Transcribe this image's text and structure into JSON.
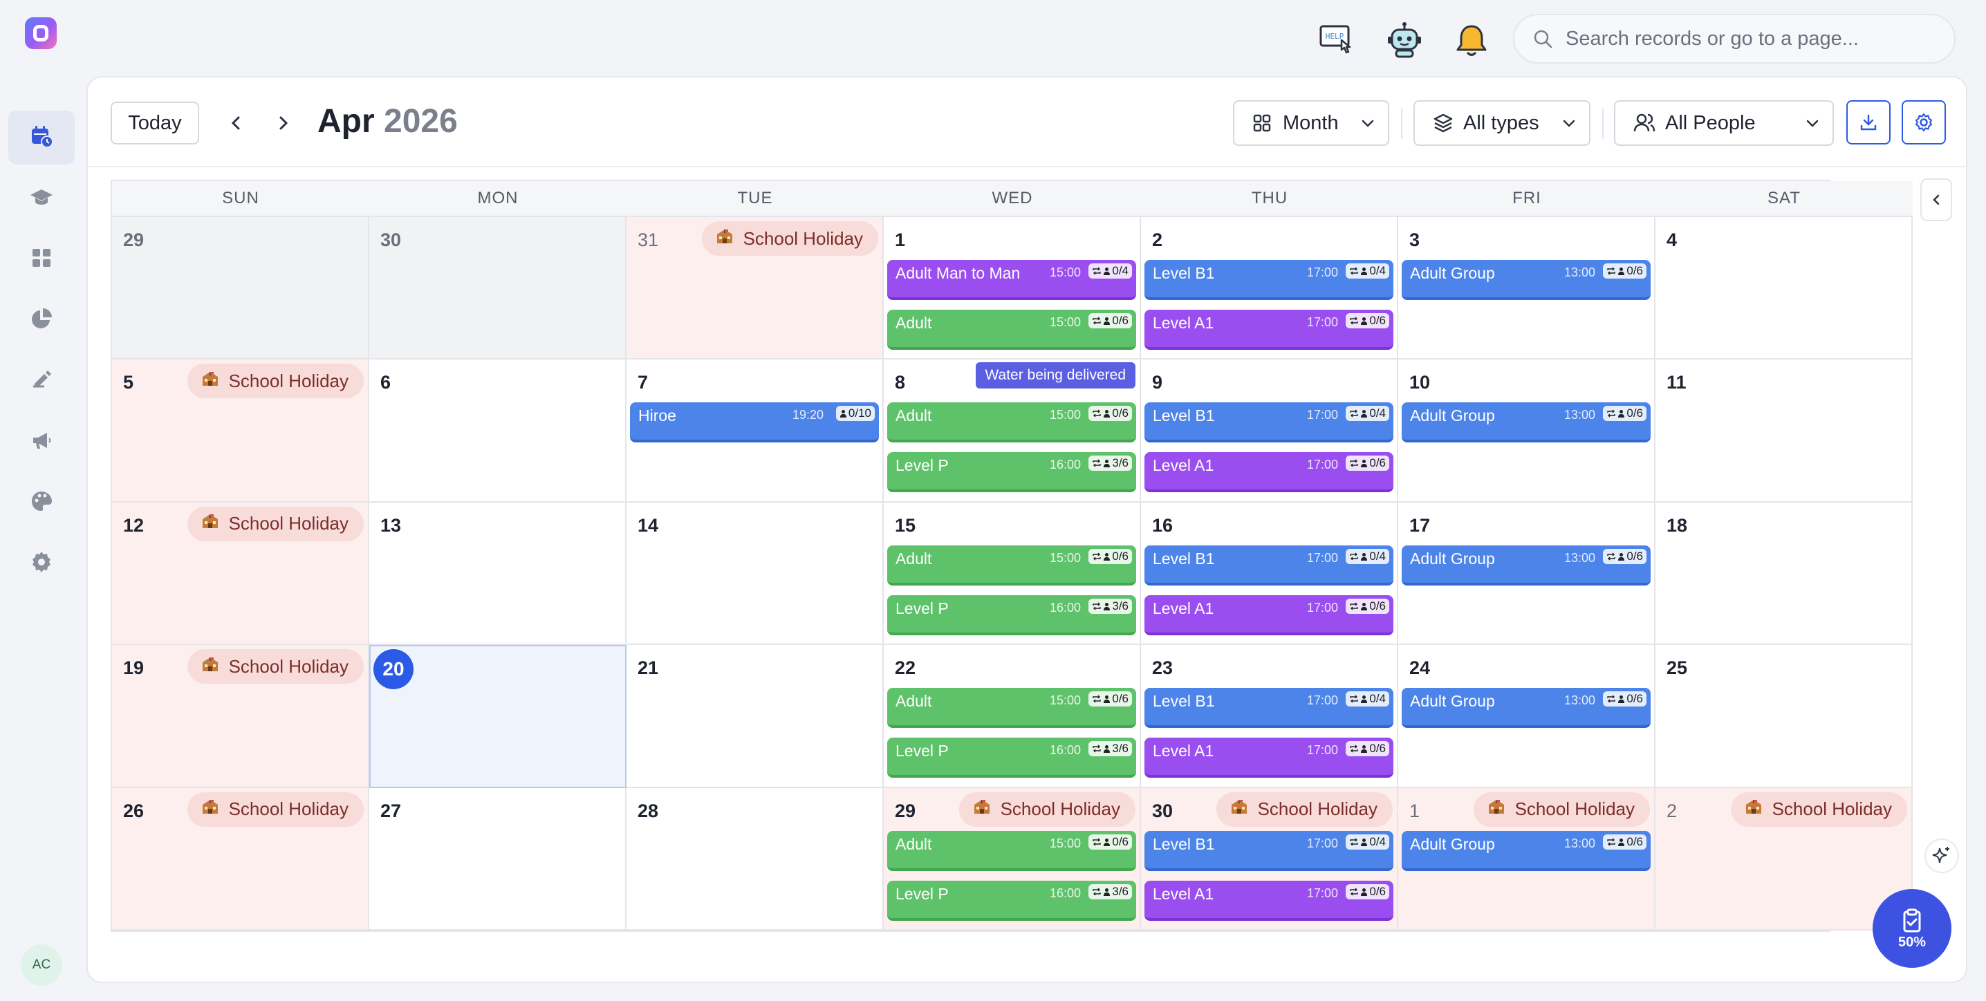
{
  "nav": {
    "items": [
      {
        "icon": "calendar-icon",
        "active": true
      },
      {
        "icon": "graduation-cap-icon",
        "active": false
      },
      {
        "icon": "dashboard-grid-icon",
        "active": false
      },
      {
        "icon": "pie-chart-icon",
        "active": false
      },
      {
        "icon": "signature-icon",
        "active": false
      },
      {
        "icon": "megaphone-icon",
        "active": false
      },
      {
        "icon": "palette-icon",
        "active": false
      },
      {
        "icon": "settings-gear-icon",
        "active": false
      }
    ],
    "avatar_initials": "AC"
  },
  "topbar": {
    "help_icon_label": "HELP",
    "search_placeholder": "Search records or go to a page..."
  },
  "toolbar": {
    "today_label": "Today",
    "month": "Apr",
    "year": "2026",
    "view_label": "Month",
    "types_label": "All types",
    "people_label": "All People"
  },
  "weekdays": [
    "SUN",
    "MON",
    "TUE",
    "WED",
    "THU",
    "FRI",
    "SAT"
  ],
  "holiday_label": "School Holiday",
  "note_label": "Water being delivered",
  "weeks": [
    [
      {
        "day": "29",
        "kind": "other"
      },
      {
        "day": "30",
        "kind": "other"
      },
      {
        "day": "31",
        "kind": "holiday-other",
        "holiday": true
      },
      {
        "day": "1",
        "events": [
          {
            "title": "Adult Man to Man",
            "time": "15:00",
            "cap": "0/4",
            "color": "purple",
            "recurring": true
          },
          {
            "title": "Adult",
            "time": "15:00",
            "cap": "0/6",
            "color": "green",
            "recurring": true
          }
        ]
      },
      {
        "day": "2",
        "events": [
          {
            "title": "Level B1",
            "time": "17:00",
            "cap": "0/4",
            "color": "blue",
            "recurring": true
          },
          {
            "title": "Level A1",
            "time": "17:00",
            "cap": "0/6",
            "color": "purple",
            "recurring": true
          }
        ]
      },
      {
        "day": "3",
        "events": [
          {
            "title": "Adult Group",
            "time": "13:00",
            "cap": "0/6",
            "color": "blue",
            "recurring": true
          }
        ]
      },
      {
        "day": "4"
      }
    ],
    [
      {
        "day": "5",
        "kind": "holiday",
        "holiday": true
      },
      {
        "day": "6"
      },
      {
        "day": "7",
        "events": [
          {
            "title": "Hiroe",
            "time": "19:20",
            "cap": "0/10",
            "color": "blue",
            "recurring": false
          }
        ]
      },
      {
        "day": "8",
        "note": true,
        "events": [
          {
            "title": "Adult",
            "time": "15:00",
            "cap": "0/6",
            "color": "green",
            "recurring": true
          },
          {
            "title": "Level P",
            "time": "16:00",
            "cap": "3/6",
            "color": "green",
            "recurring": true
          }
        ]
      },
      {
        "day": "9",
        "events": [
          {
            "title": "Level B1",
            "time": "17:00",
            "cap": "0/4",
            "color": "blue",
            "recurring": true
          },
          {
            "title": "Level A1",
            "time": "17:00",
            "cap": "0/6",
            "color": "purple",
            "recurring": true
          }
        ]
      },
      {
        "day": "10",
        "events": [
          {
            "title": "Adult Group",
            "time": "13:00",
            "cap": "0/6",
            "color": "blue",
            "recurring": true
          }
        ]
      },
      {
        "day": "11"
      }
    ],
    [
      {
        "day": "12",
        "kind": "holiday",
        "holiday": true
      },
      {
        "day": "13"
      },
      {
        "day": "14"
      },
      {
        "day": "15",
        "events": [
          {
            "title": "Adult",
            "time": "15:00",
            "cap": "0/6",
            "color": "green",
            "recurring": true
          },
          {
            "title": "Level P",
            "time": "16:00",
            "cap": "3/6",
            "color": "green",
            "recurring": true
          }
        ]
      },
      {
        "day": "16",
        "events": [
          {
            "title": "Level B1",
            "time": "17:00",
            "cap": "0/4",
            "color": "blue",
            "recurring": true
          },
          {
            "title": "Level A1",
            "time": "17:00",
            "cap": "0/6",
            "color": "purple",
            "recurring": true
          }
        ]
      },
      {
        "day": "17",
        "events": [
          {
            "title": "Adult Group",
            "time": "13:00",
            "cap": "0/6",
            "color": "blue",
            "recurring": true
          }
        ]
      },
      {
        "day": "18"
      }
    ],
    [
      {
        "day": "19",
        "kind": "holiday",
        "holiday": true
      },
      {
        "day": "20",
        "kind": "today"
      },
      {
        "day": "21"
      },
      {
        "day": "22",
        "events": [
          {
            "title": "Adult",
            "time": "15:00",
            "cap": "0/6",
            "color": "green",
            "recurring": true
          },
          {
            "title": "Level P",
            "time": "16:00",
            "cap": "3/6",
            "color": "green",
            "recurring": true
          }
        ]
      },
      {
        "day": "23",
        "events": [
          {
            "title": "Level B1",
            "time": "17:00",
            "cap": "0/4",
            "color": "blue",
            "recurring": true
          },
          {
            "title": "Level A1",
            "time": "17:00",
            "cap": "0/6",
            "color": "purple",
            "recurring": true
          }
        ]
      },
      {
        "day": "24",
        "events": [
          {
            "title": "Adult Group",
            "time": "13:00",
            "cap": "0/6",
            "color": "blue",
            "recurring": true
          }
        ]
      },
      {
        "day": "25"
      }
    ],
    [
      {
        "day": "26",
        "kind": "holiday",
        "holiday": true
      },
      {
        "day": "27"
      },
      {
        "day": "28"
      },
      {
        "day": "29",
        "kind": "holiday",
        "holiday": true,
        "events": [
          {
            "title": "Adult",
            "time": "15:00",
            "cap": "0/6",
            "color": "green",
            "recurring": true
          },
          {
            "title": "Level P",
            "time": "16:00",
            "cap": "3/6",
            "color": "green",
            "recurring": true
          }
        ]
      },
      {
        "day": "30",
        "kind": "holiday",
        "holiday": true,
        "events": [
          {
            "title": "Level B1",
            "time": "17:00",
            "cap": "0/4",
            "color": "blue",
            "recurring": true
          },
          {
            "title": "Level A1",
            "time": "17:00",
            "cap": "0/6",
            "color": "purple",
            "recurring": true
          }
        ]
      },
      {
        "day": "1",
        "kind": "holiday-next",
        "holiday": true,
        "events": [
          {
            "title": "Adult Group",
            "time": "13:00",
            "cap": "0/6",
            "color": "blue",
            "recurring": true
          }
        ]
      },
      {
        "day": "2",
        "kind": "holiday-next",
        "holiday": true
      }
    ]
  ],
  "fab": {
    "progress_label": "50%",
    "progress_value": 0.5
  }
}
